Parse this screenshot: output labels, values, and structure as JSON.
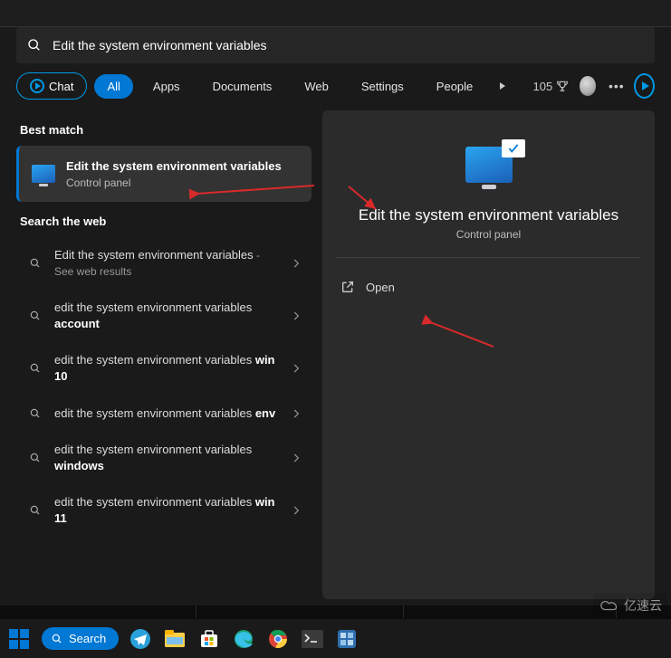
{
  "search": {
    "query": "Edit the system environment variables"
  },
  "filters": {
    "chat": "Chat",
    "all": "All",
    "apps": "Apps",
    "documents": "Documents",
    "web": "Web",
    "settings": "Settings",
    "people": "People",
    "rewards_points": "105"
  },
  "sections": {
    "best_match": "Best match",
    "search_web": "Search the web"
  },
  "best_match": {
    "title": "Edit the system environment variables",
    "subtitle": "Control panel"
  },
  "web_results": [
    {
      "prefix": "Edit the system environment variables",
      "bold": "",
      "suffix_hint": " - See web results"
    },
    {
      "prefix": "edit the system environment variables ",
      "bold": "account",
      "suffix_hint": ""
    },
    {
      "prefix": "edit the system environment variables ",
      "bold": "win 10",
      "suffix_hint": ""
    },
    {
      "prefix": "edit the system environment variables ",
      "bold": "env",
      "suffix_hint": ""
    },
    {
      "prefix": "edit the system environment variables ",
      "bold": "windows",
      "suffix_hint": ""
    },
    {
      "prefix": "edit the system environment variables ",
      "bold": "win 11",
      "suffix_hint": ""
    }
  ],
  "details": {
    "title": "Edit the system environment variables",
    "subtitle": "Control panel",
    "open": "Open"
  },
  "taskbar": {
    "search": "Search"
  },
  "watermark": "亿速云"
}
